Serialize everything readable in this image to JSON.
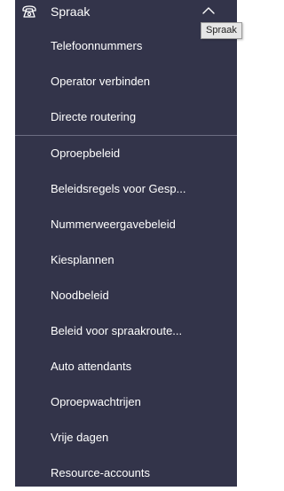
{
  "header": {
    "title": "Spraak",
    "icon": "phone-icon",
    "chevron_icon": "chevron-up-icon",
    "tooltip": "Spraak"
  },
  "groups": [
    {
      "items": [
        {
          "label": "Telefoonnummers"
        },
        {
          "label": "Operator verbinden"
        },
        {
          "label": "Directe routering"
        }
      ]
    },
    {
      "items": [
        {
          "label": "Oproepbeleid"
        },
        {
          "label": "Beleidsregels voor Gesp..."
        },
        {
          "label": "Nummerweergavebeleid"
        },
        {
          "label": "Kiesplannen"
        },
        {
          "label": "Noodbeleid"
        },
        {
          "label": "Beleid voor spraakroute..."
        },
        {
          "label": "Auto attendants"
        },
        {
          "label": "Oproepwachtrijen"
        },
        {
          "label": "Vrije dagen"
        },
        {
          "label": "Resource-accounts"
        }
      ]
    }
  ],
  "colors": {
    "panel_background": "#33344a",
    "text": "#ffffff",
    "divider": "#6c6d82",
    "tooltip_background": "#e6e6e6"
  }
}
